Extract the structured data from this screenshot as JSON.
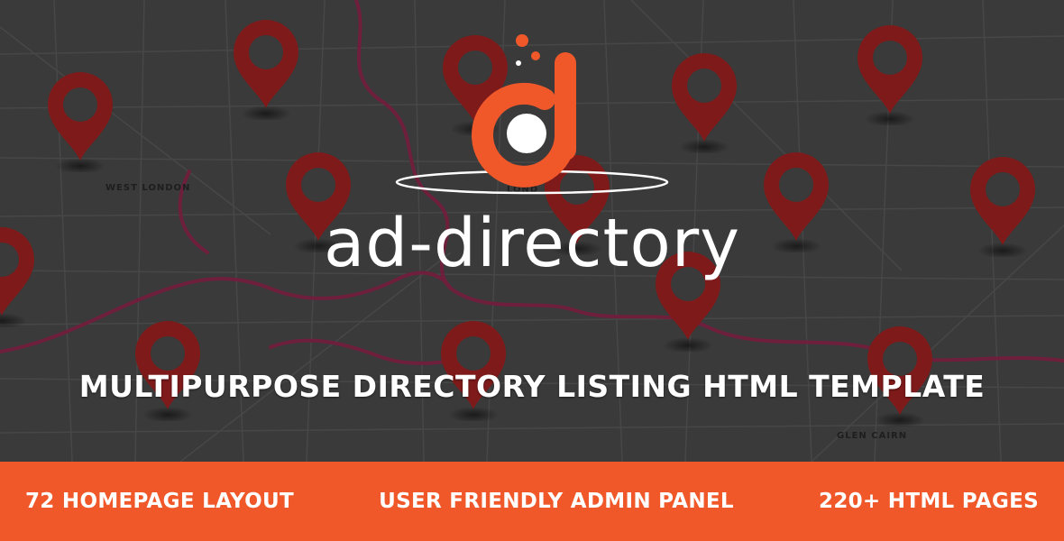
{
  "colors": {
    "background": "#3a3a3a",
    "road": "#4a4a4a",
    "river": "#6e1f3b",
    "pin": "#7e1a1a",
    "pin_hole": "#3a3a3a",
    "accent": "#f0582a",
    "text": "#ffffff"
  },
  "map": {
    "labels": [
      "WEST LONDON",
      "GLEN CAIRN",
      "LOND"
    ]
  },
  "logo": {
    "icon": "ad-logo-icon",
    "brand_name": "ad-directory"
  },
  "tagline": "MULTIPURPOSE DIRECTORY LISTING HTML TEMPLATE",
  "features": [
    "72 HOMEPAGE LAYOUT",
    "USER FRIENDLY ADMIN PANEL",
    "220+ HTML PAGES"
  ],
  "icons": [
    "map-pin-icon"
  ]
}
